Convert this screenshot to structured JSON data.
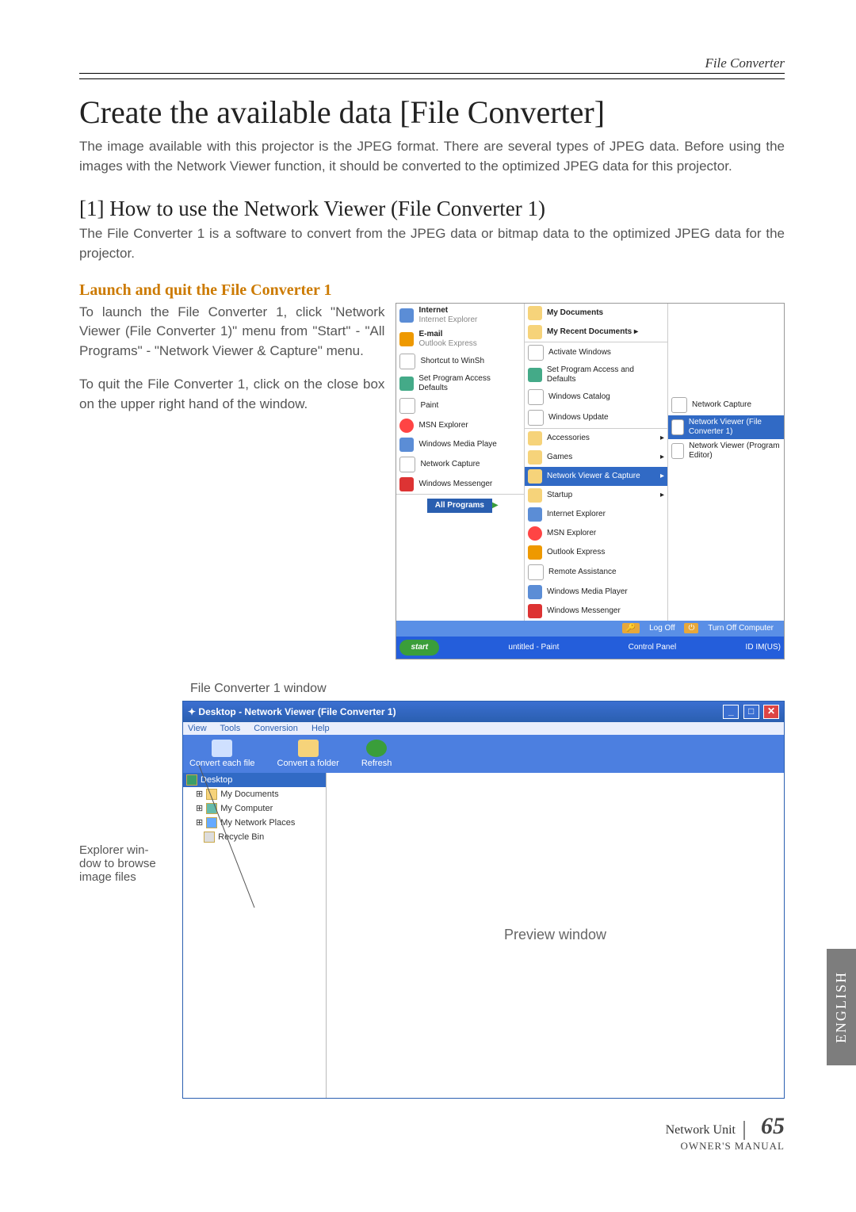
{
  "header": {
    "right_label": "File Converter"
  },
  "title": "Create the available data [File Converter]",
  "intro": "The image available with this projector is the JPEG format. There are several types of JPEG data. Before using the images with the Network Viewer function, it should be converted to the optimized JPEG data for this projector.",
  "sub1_title": "[1] How to use the Network Viewer (File Converter 1)",
  "sub1_body": "The File Converter 1 is a software to convert from the JPEG data or bitmap data to the optimized JPEG data for the projector.",
  "orange_heading": "Launch and quit the File Converter 1",
  "para_a": "To launch the File Converter 1, click \"Network Viewer (File Converter 1)\" menu from \"Start\" - \"All Programs\" - \"Network Viewer & Capture\" menu.",
  "para_b": "To quit the File Converter 1, click on the close box on the upper right hand of the window.",
  "startmenu": {
    "c1": {
      "internet": "Internet",
      "internet_sub": "Internet Explorer",
      "email": "E-mail",
      "email_sub": "Outlook Express",
      "shortcut": "Shortcut to WinSh",
      "setprog": "Set Program Access Defaults",
      "paint": "Paint",
      "msn": "MSN Explorer",
      "wmp": "Windows Media Playe",
      "netcap": "Network Capture",
      "winmsg": "Windows Messenger",
      "allprograms": "All Programs"
    },
    "c2": {
      "mydocs": "My Documents",
      "recent": "My Recent Documents  ▸",
      "activate": "Activate Windows",
      "setprog": "Set Program Access and Defaults",
      "wincat": "Windows Catalog",
      "winupd": "Windows Update",
      "acc": "Accessories",
      "games": "Games",
      "nvc": "Network Viewer & Capture",
      "startup": "Startup",
      "ie": "Internet Explorer",
      "msn": "MSN Explorer",
      "outlook": "Outlook Express",
      "remote": "Remote Assistance",
      "wmp": "Windows Media Player",
      "winmsg": "Windows Messenger"
    },
    "c3": {
      "netcap": "Network Capture",
      "fc1": "Network Viewer (File Converter 1)",
      "progedit": "Network Viewer (Program Editor)"
    },
    "logoff": "Log Off",
    "turnoff": "Turn Off Computer",
    "start": "start",
    "task1": "untitled - Paint",
    "task2": "Control Panel",
    "tray": "ID IM(US)"
  },
  "fc_caption": "File Converter 1 window",
  "fc": {
    "title": "Desktop - Network Viewer (File Converter 1)",
    "menu": {
      "view": "View",
      "tools": "Tools",
      "conversion": "Conversion",
      "help": "Help"
    },
    "tool": {
      "each": "Convert each file",
      "folder": "Convert a folder",
      "refresh": "Refresh"
    },
    "tree": {
      "desktop": "Desktop",
      "mydocs": "My Documents",
      "mycomp": "My Computer",
      "netplaces": "My Network Places",
      "recycle": "Recycle Bin"
    },
    "preview_label": "Preview window"
  },
  "explorer_label": "Explorer win-\ndow to browse image files",
  "side_tab": "ENGLISH",
  "footer": {
    "nu": "Network Unit",
    "page": "65",
    "om": "OWNER'S MANUAL"
  }
}
